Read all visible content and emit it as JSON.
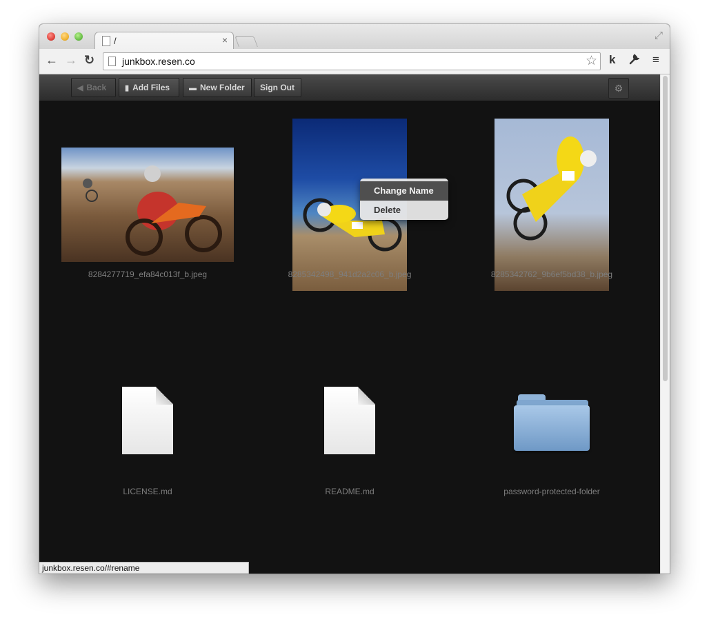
{
  "browser": {
    "tab_title": "/",
    "tab_close": "×",
    "url": "junkbox.resen.co",
    "status_url": "junkbox.resen.co/#rename",
    "icons": {
      "back": "←",
      "forward": "→",
      "reload": "↻",
      "star": "☆",
      "extension": "k",
      "wrench": "🔧",
      "menu": "≡",
      "fullscreen": "⤢"
    }
  },
  "app_toolbar": {
    "back_label": "Back",
    "add_files_label": "Add Files",
    "new_folder_label": "New Folder",
    "sign_out_label": "Sign Out",
    "settings_icon": "⚙"
  },
  "files": [
    {
      "name": "8284277719_efa84c013f_b.jpeg",
      "kind": "image"
    },
    {
      "name": "8285342498_941d2a2c06_b.jpeg",
      "kind": "image"
    },
    {
      "name": "8285342762_9b6ef5bd38_b.jpeg",
      "kind": "image"
    },
    {
      "name": "LICENSE.md",
      "kind": "document"
    },
    {
      "name": "README.md",
      "kind": "document"
    },
    {
      "name": "password-protected-folder",
      "kind": "folder"
    }
  ],
  "context_menu": {
    "items": [
      {
        "label": "Change Name",
        "selected": true
      },
      {
        "label": "Delete",
        "selected": false
      }
    ]
  }
}
